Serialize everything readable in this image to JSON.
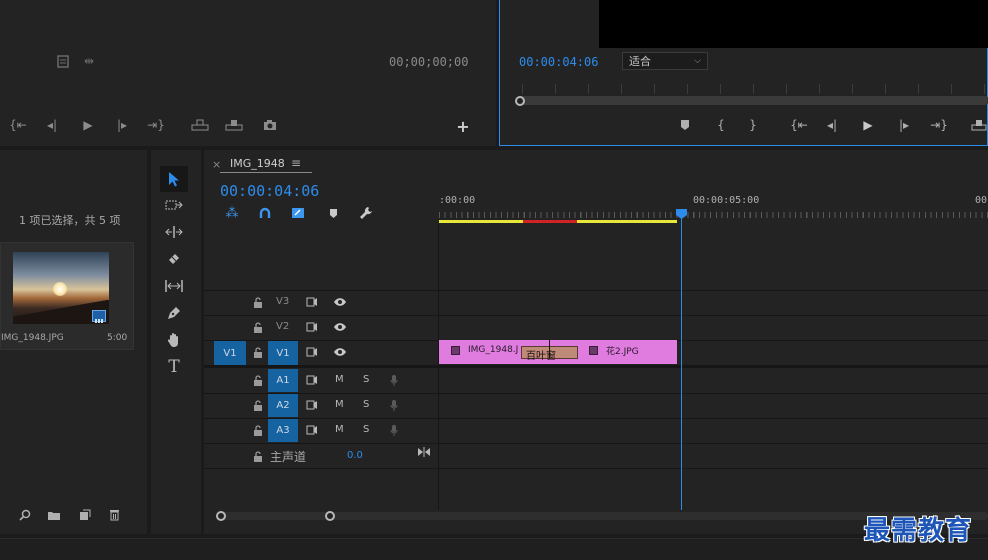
{
  "source_monitor": {
    "timecode": "00;00;00;00"
  },
  "program_monitor": {
    "timecode": "00:00:04:06",
    "fit_label": "适合"
  },
  "project_panel": {
    "selection_status": "1 项已选择，共 5 项",
    "clip": {
      "name": "IMG_1948.JPG",
      "duration": "5:00"
    }
  },
  "timeline": {
    "tab_close": "×",
    "sequence_name": "IMG_1948",
    "menu_glyph": "≡",
    "timecode": "00:00:04:06",
    "ruler": [
      ":00:00",
      "00:00:05:00",
      "00"
    ],
    "video_tracks": [
      {
        "id": "V3",
        "source": ""
      },
      {
        "id": "V2",
        "source": ""
      },
      {
        "id": "V1",
        "source": "V1"
      }
    ],
    "audio_tracks": [
      {
        "id": "A1",
        "mute": "M",
        "solo": "S"
      },
      {
        "id": "A2",
        "mute": "M",
        "solo": "S"
      },
      {
        "id": "A3",
        "mute": "M",
        "solo": "S"
      }
    ],
    "master": {
      "label": "主声道",
      "value": "0.0"
    },
    "clips": {
      "clip_a": "IMG_1948.J",
      "transition": "百叶窗",
      "clip_b": "花2.JPG"
    },
    "playhead_fraction": 0.849
  },
  "watermark": "最需教育",
  "colors": {
    "accent": "#2d8ceb",
    "clip": "#e07be0",
    "track_button": "#1563a0",
    "work_area": "#e8e83a",
    "render_red": "#d02424"
  }
}
